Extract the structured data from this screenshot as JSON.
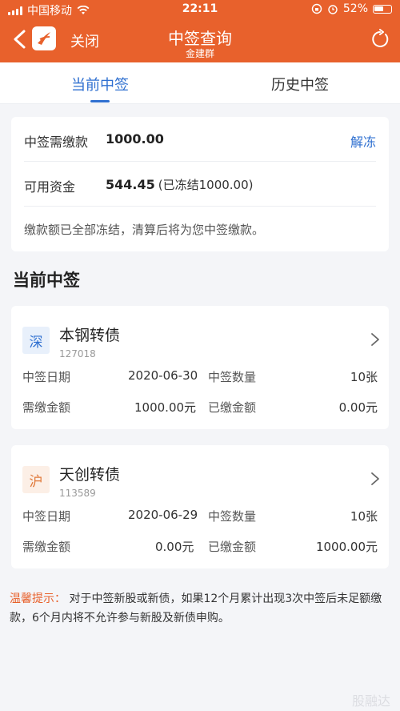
{
  "status_bar": {
    "carrier": "中国移动",
    "time": "22:11",
    "battery": "52%"
  },
  "nav": {
    "close_label": "关闭",
    "title": "中签查询",
    "subtitle": "金建群"
  },
  "tabs": [
    {
      "label": "当前中签",
      "active": true
    },
    {
      "label": "历史中签",
      "active": false
    }
  ],
  "funds": {
    "required_label": "中签需缴款",
    "required_value": "1000.00",
    "unfreeze_label": "解冻",
    "available_label": "可用资金",
    "available_value": "544.45",
    "frozen_text": "(已冻结1000.00)",
    "note": "缴款额已全部冻结，清算后将为您中签缴款。"
  },
  "section_title": "当前中签",
  "bonds": [
    {
      "market": "深",
      "name": "本钢转债",
      "code": "127018",
      "date_label": "中签日期",
      "date": "2020-06-30",
      "qty_label": "中签数量",
      "qty": "10张",
      "due_label": "需缴金额",
      "due": "1000.00元",
      "paid_label": "已缴金额",
      "paid": "0.00元"
    },
    {
      "market": "沪",
      "name": "天创转债",
      "code": "113589",
      "date_label": "中签日期",
      "date": "2020-06-29",
      "qty_label": "中签数量",
      "qty": "10张",
      "due_label": "需缴金额",
      "due": "0.00元",
      "paid_label": "已缴金额",
      "paid": "1000.00元"
    }
  ],
  "tip": {
    "label": "温馨提示：",
    "text": "对于中签新股或新债，如果12个月累计出现3次中签后未足额缴款，6个月内将不允许参与新股及新债申购。"
  },
  "watermark": "股融达",
  "colors": {
    "brand": "#e8612c",
    "accent": "#2e6fd0"
  }
}
